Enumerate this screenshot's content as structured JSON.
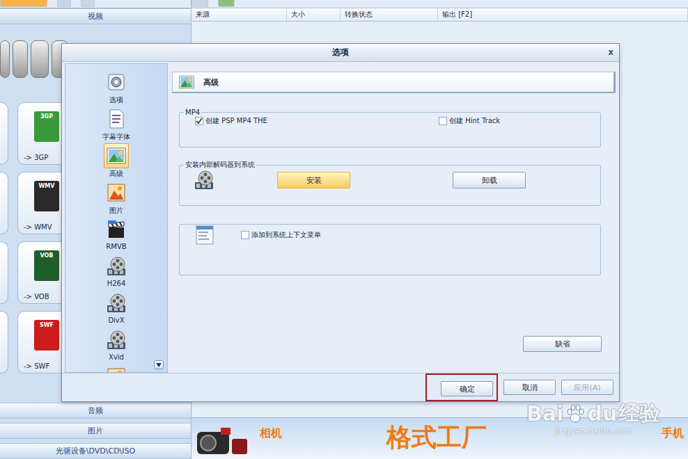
{
  "background": {
    "top_category": "视频",
    "bottom_categories": [
      "音频",
      "图片",
      "光驱设备\\DVD\\CD\\ISO"
    ],
    "formats": [
      {
        "label": "-> 3GP",
        "badge": "3GP",
        "color": "#3a9a3a"
      },
      {
        "label": "-> WMV",
        "badge": "WMV",
        "color": "#2a2a2a"
      },
      {
        "label": "-> VOB",
        "badge": "VOB",
        "color": "#1f5e2a"
      },
      {
        "label": "-> SWF",
        "badge": "SWF",
        "color": "#cc1b1b"
      }
    ],
    "file_list": {
      "columns": [
        "来源",
        "大小",
        "转换状态",
        "输出 [F2]"
      ]
    },
    "banner": {
      "title": "格式工厂",
      "left_label": "相机",
      "right_label": "手机"
    },
    "watermark": {
      "brand_left": "Bai",
      "brand_right": "du",
      "brand_cn": "经验",
      "url": "jingyan.baidu.com"
    }
  },
  "dialog": {
    "title": "选项",
    "close": "x",
    "nav": [
      {
        "label": "选项",
        "selected": false
      },
      {
        "label": "字幕字体",
        "selected": false
      },
      {
        "label": "高级",
        "selected": true
      },
      {
        "label": "图片",
        "selected": false
      },
      {
        "label": "RMVB",
        "selected": false
      },
      {
        "label": "H264",
        "selected": false
      },
      {
        "label": "DivX",
        "selected": false
      },
      {
        "label": "Xvid",
        "selected": false
      }
    ],
    "panel_title": "高级",
    "mp4_group": {
      "title": "MP4",
      "options": [
        {
          "label": "创建 PSP MP4 THE",
          "checked": true
        },
        {
          "label": "创建 Hint Track",
          "checked": false
        }
      ]
    },
    "codec_group": {
      "title": "安装内部解码器到系统",
      "buttons": [
        {
          "label": "安装",
          "highlighted": true
        },
        {
          "label": "卸载",
          "highlighted": false
        }
      ]
    },
    "context_group": {
      "option": {
        "label": "添加到系统上下文菜单",
        "checked": false
      }
    },
    "default_button": "缺省",
    "footer_buttons": [
      {
        "label": "确定",
        "emphasized": true,
        "disabled": false
      },
      {
        "label": "取消",
        "emphasized": false,
        "disabled": false
      },
      {
        "label": "应用(A)",
        "emphasized": false,
        "disabled": true
      }
    ]
  }
}
